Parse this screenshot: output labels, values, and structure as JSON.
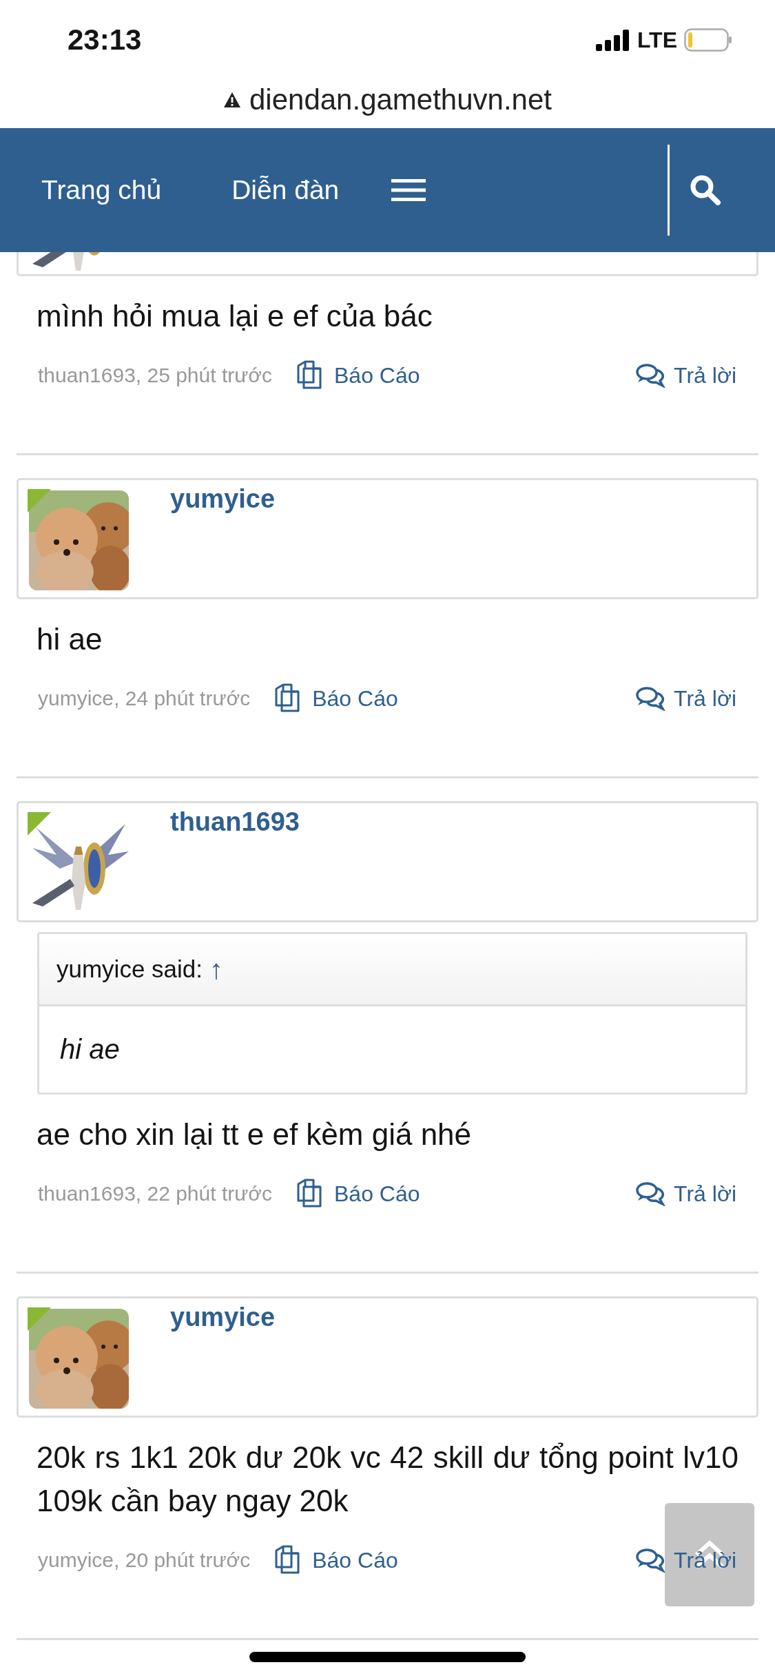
{
  "status_bar": {
    "time": "23:13",
    "network": "LTE"
  },
  "address_bar": {
    "url": "diendan.gamethuvn.net",
    "insecure": true
  },
  "nav": {
    "items": [
      {
        "label": "Trang chủ"
      },
      {
        "label": "Diễn đàn"
      }
    ]
  },
  "posts": [
    {
      "message": "mình hỏi mua lại e ef của bác",
      "meta": "thuan1693, 25 phút trước",
      "report": "Báo Cáo",
      "reply": "Trả lời"
    },
    {
      "author": "yumyice",
      "online": true,
      "message": "hi ae",
      "meta": "yumyice, 24 phút trước",
      "report": "Báo Cáo",
      "reply": "Trả lời"
    },
    {
      "author": "thuan1693",
      "online": true,
      "quote": {
        "attribution": "yumyice said:",
        "jump": "↑",
        "text": "hi ae"
      },
      "message": "ae cho xin lại tt e ef kèm giá nhé",
      "meta": "thuan1693, 22 phút trước",
      "report": "Báo Cáo",
      "reply": "Trả lời"
    },
    {
      "author": "yumyice",
      "online": true,
      "message": "20k rs 1k1 20k dư 20k vc 42 skill dư tổng point lv10 109k cần bay ngay 20k",
      "meta": "yumyice, 20 phút trước",
      "report": "Báo Cáo",
      "reply": "Trả lời"
    }
  ]
}
